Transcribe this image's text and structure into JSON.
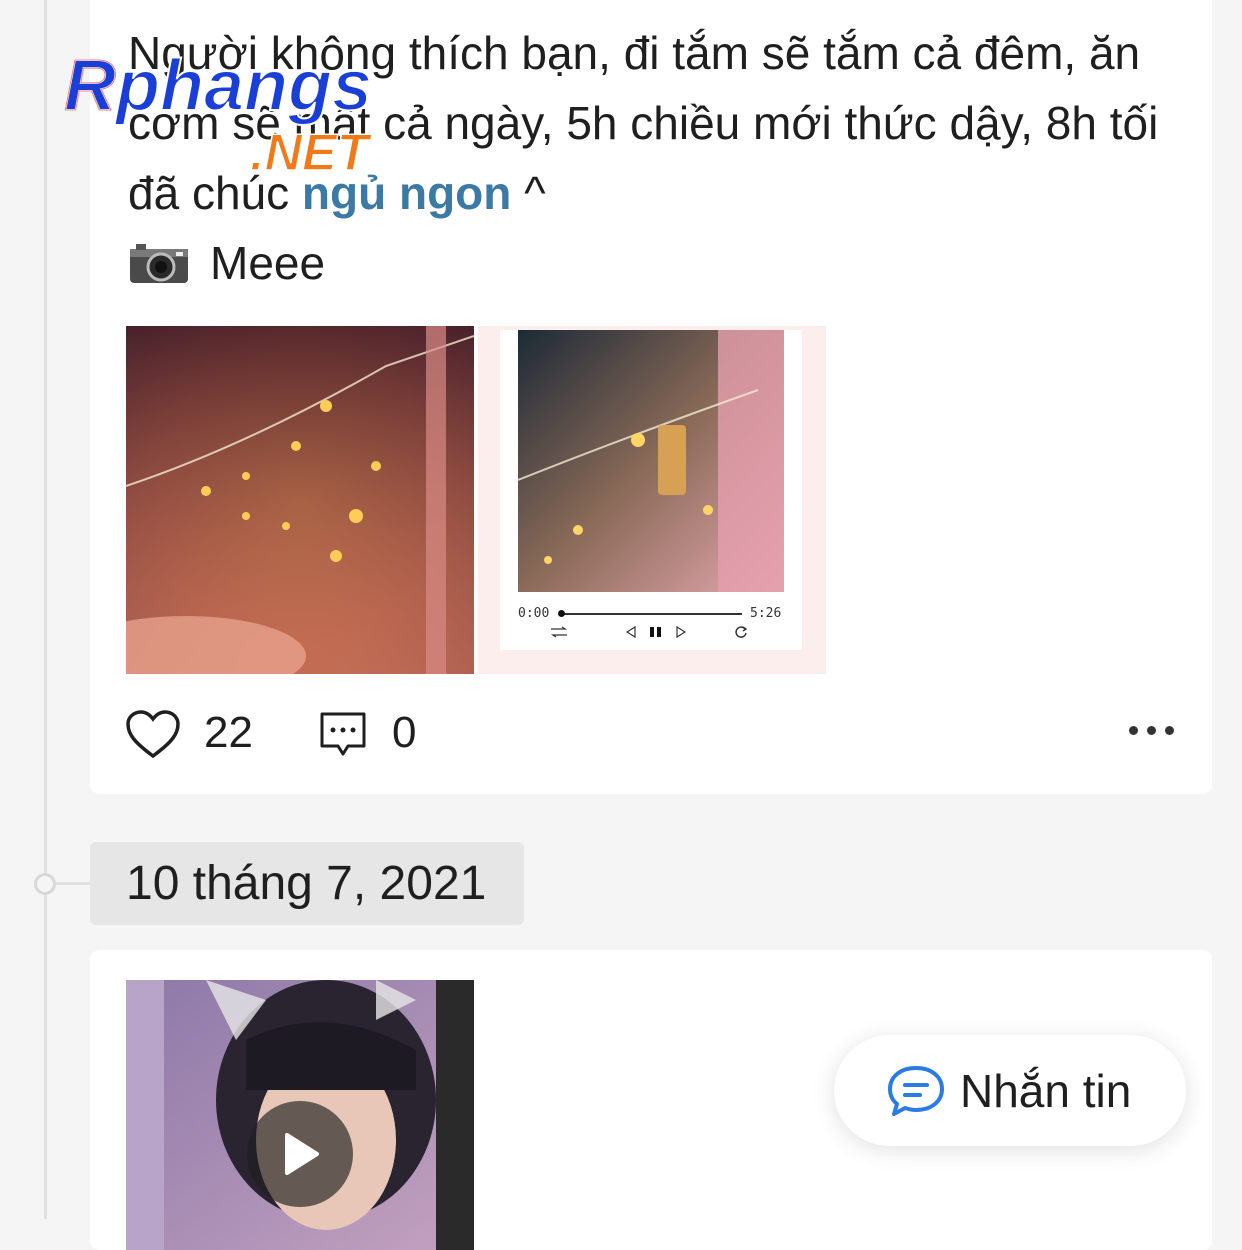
{
  "post": {
    "text_main": "Người không thích bạn, đi tắm sẽ tắm cả đêm, ăn cơm sẽ mất cả ngày, 5h chiều mới thức dậy, 8h tối đã chúc",
    "hashtag": "ngủ ngon",
    "text_tail": " ^",
    "caption_credit": "Meee",
    "player": {
      "start_time": "0:00",
      "end_time": "5:26"
    },
    "likes": "22",
    "comments": "0"
  },
  "timeline": {
    "date": "10 tháng 7, 2021"
  },
  "message_button": {
    "label": "Nhắn tin"
  },
  "watermark": {
    "brand": "Rphangs",
    "domain": ".NET"
  },
  "colors": {
    "hashtag": "#3c7aa6",
    "message_icon": "#2a7be4",
    "background": "#f5f5f5"
  }
}
